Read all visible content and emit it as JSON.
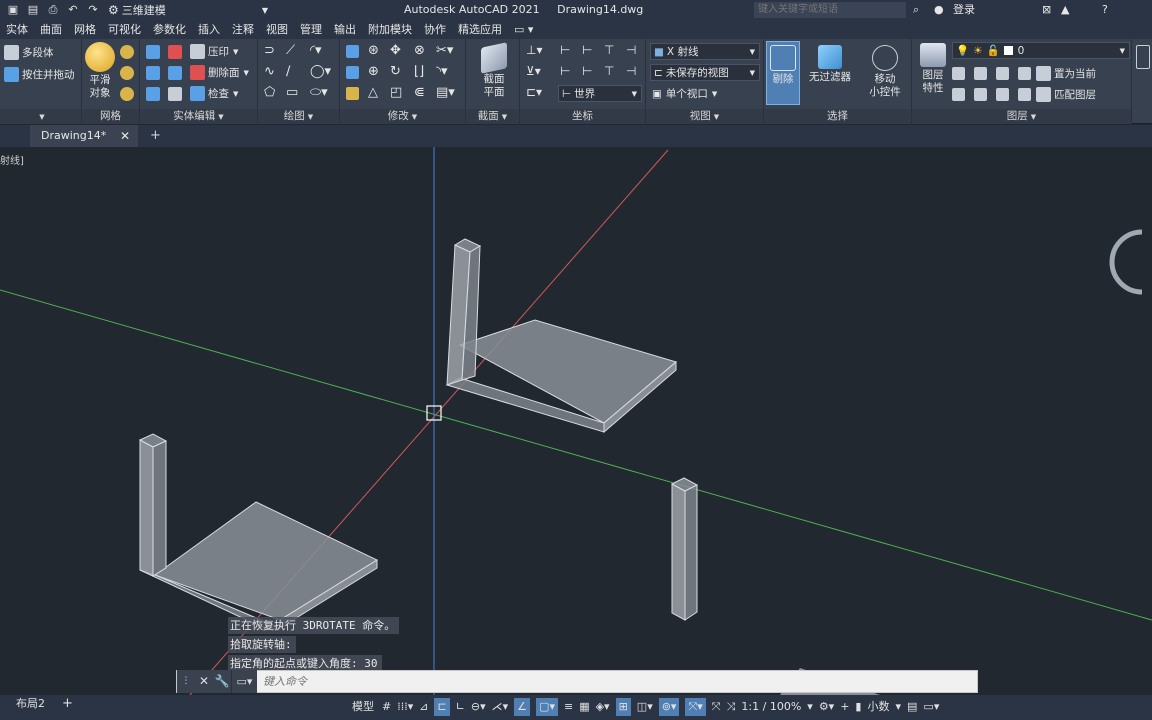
{
  "titlebar": {
    "workspace": "三维建模",
    "app_name": "Autodesk AutoCAD 2021",
    "document": "Drawing14.dwg",
    "search_placeholder": "键入关键字或短语",
    "sign_in": "登录",
    "help": "?"
  },
  "menu": {
    "tabs": [
      "实体",
      "曲面",
      "网格",
      "可视化",
      "参数化",
      "插入",
      "注释",
      "视图",
      "管理",
      "输出",
      "附加模块",
      "协作",
      "精选应用"
    ]
  },
  "ribbon": {
    "polysolid": "多段体",
    "presspull": "按住并拖动",
    "smooth_object_1": "平滑",
    "smooth_object_2": "对象",
    "mesh_panel": "网格",
    "imprint": "压印",
    "separate_faces": "删除面",
    "check": "检查",
    "solid_edit_panel": "实体编辑",
    "draw_panel": "绘图",
    "modify_panel": "修改",
    "section_plane_1": "截面",
    "section_plane_2": "平面",
    "section_panel": "截面",
    "coords_world": "世界",
    "coords_panel": "坐标",
    "view_x_ray": "X 射线",
    "view_unsaved": "未保存的视图",
    "view_single": "单个视口",
    "view_panel": "视图",
    "culling": "剔除",
    "no_filter": "无过滤器",
    "move_gizmo_1": "移动",
    "move_gizmo_2": "小控件",
    "selection_panel": "选择",
    "layer_props_1": "图层",
    "layer_props_2": "特性",
    "layer_current": "0",
    "set_current": "置为当前",
    "match_layer": "匹配图层",
    "layers_panel": "图层"
  },
  "filetabs": {
    "active": "Drawing14*",
    "add": "+"
  },
  "viewport": {
    "label": "射线]"
  },
  "command": {
    "history": [
      "正在恢复执行 3DROTATE 命令。",
      "拾取旋转轴:",
      "指定角的起点或键入角度: 30"
    ],
    "input_placeholder": "键入命令"
  },
  "statusbar": {
    "layout": "布局2",
    "add_layout": "+",
    "model": "模型",
    "scale": "1:1 / 100%",
    "units": "小数"
  },
  "colors": {
    "viewport_bg": "#212830",
    "ribbon_bg": "#38414f",
    "axis_x": "#e05a5a",
    "axis_y": "#4caf50",
    "axis_z": "#4a7fd8",
    "solid_face": "#8a8f96"
  }
}
